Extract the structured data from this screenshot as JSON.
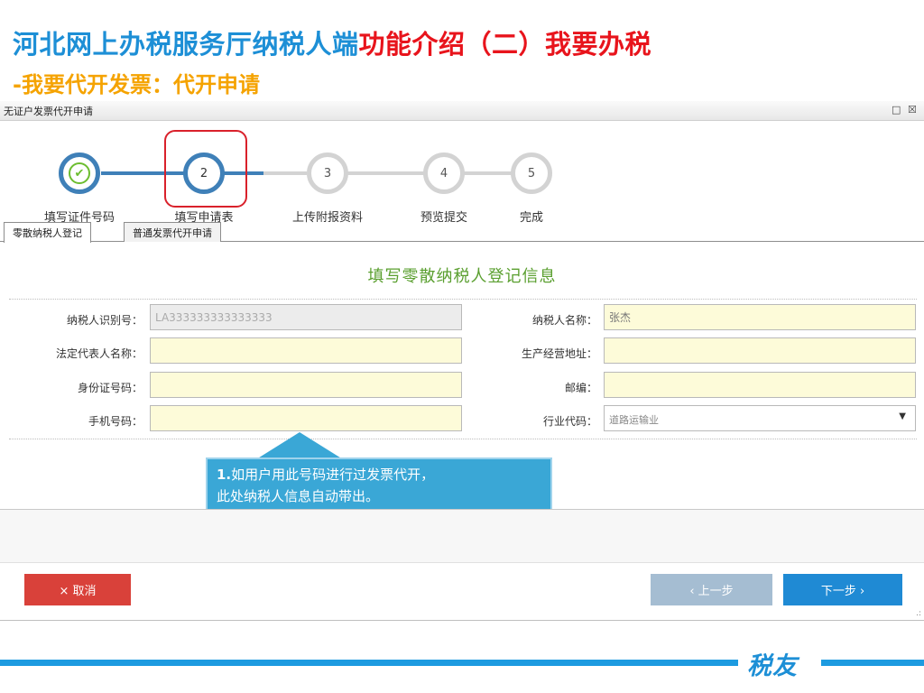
{
  "slide": {
    "title_main": "河北网上办税服务厅纳税人端",
    "title_highlight": "功能介绍（二）我要办税",
    "subtitle": "-我要代开发票：代开申请"
  },
  "window": {
    "title": "无证户发票代开申请",
    "controls": [
      "□",
      "☒"
    ]
  },
  "steps": [
    {
      "number": "✔",
      "label": "填写证件号码",
      "state": "done"
    },
    {
      "number": "2",
      "label": "填写申请表",
      "state": "active"
    },
    {
      "number": "3",
      "label": "上传附报资料",
      "state": "pending"
    },
    {
      "number": "4",
      "label": "预览提交",
      "state": "pending"
    },
    {
      "number": "5",
      "label": "完成",
      "state": "pending"
    }
  ],
  "tabs": [
    {
      "label": "零散纳税人登记",
      "active": true
    },
    {
      "label": "普通发票代开申请",
      "active": false
    }
  ],
  "form": {
    "heading": "填写零散纳税人登记信息",
    "taxpayer_id": {
      "label": "纳税人识别号：",
      "value": "LA333333333333333"
    },
    "taxpayer_name": {
      "label": "纳税人名称：",
      "value": "张杰"
    },
    "legal_rep": {
      "label": "法定代表人名称：",
      "value": ""
    },
    "address": {
      "label": "生产经营地址：",
      "value": ""
    },
    "id_card": {
      "label": "身份证号码：",
      "value": ""
    },
    "postcode": {
      "label": "邮编：",
      "value": ""
    },
    "phone": {
      "label": "手机号码：",
      "value": ""
    },
    "industry": {
      "label": "行业代码：",
      "value": "道路运输业"
    }
  },
  "callout": {
    "prefix": "1.",
    "line1": "如用户用此号码进行过发票代开，",
    "line2": "此处纳税人信息自动带出。"
  },
  "buttons": {
    "cancel": "× 取消",
    "prev": "‹ 上一步",
    "next": "下一步 ›"
  },
  "footer": {
    "brand": "税友"
  },
  "colors": {
    "title_blue": "#1d8fd6",
    "title_red": "#e8141c",
    "subtitle_orange": "#f5a300",
    "step_blue": "#3f80b8",
    "step_grey": "#d3d3d3",
    "check_green": "#6cbd2f",
    "form_green": "#5a9f2f",
    "input_yellow": "#fdfbd9",
    "cancel_red": "#d9413a",
    "prev_grey_blue": "#a5bdd2",
    "next_blue": "#1f8ad4",
    "callout_blue": "#3aa7d6"
  }
}
